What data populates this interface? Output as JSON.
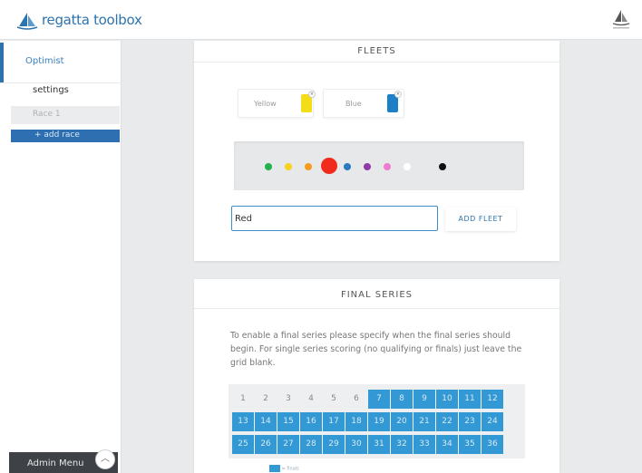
{
  "app": {
    "title": "regatta toolbox"
  },
  "sidebar": {
    "class_name": "Optimist",
    "settings_label": "settings",
    "race_label": "Race 1",
    "add_race_label": "+ add race",
    "admin_label": "Admin Menu"
  },
  "fleets": {
    "title": "FLEETS",
    "tags": [
      {
        "label": "Yellow",
        "color": "#f3dc1a"
      },
      {
        "label": "Blue",
        "color": "#1f7fc6"
      }
    ],
    "palette": [
      {
        "color": "#22b14c",
        "selected": false
      },
      {
        "color": "#f7d21e",
        "selected": false
      },
      {
        "color": "#f39c1f",
        "selected": false
      },
      {
        "color": "#f02a1d",
        "selected": true
      },
      {
        "color": "#2a7ac0",
        "selected": false
      },
      {
        "color": "#8f3aa6",
        "selected": false
      },
      {
        "color": "#f07ad0",
        "selected": false
      },
      {
        "color": "#ffffff",
        "selected": false
      },
      {
        "color": "#111111",
        "selected": false
      }
    ],
    "input_value": "Red",
    "add_button_label": "ADD FLEET"
  },
  "final_series": {
    "title": "FINAL SERIES",
    "description": "To enable a final series please specify when the final series should begin. For single series scoring (no qualifying or finals) just leave the grid blank.",
    "grid": {
      "rows": [
        [
          "1",
          "2",
          "3",
          "4",
          "5",
          "6",
          "7",
          "8",
          "9",
          "10",
          "11",
          "12"
        ],
        [
          "13",
          "14",
          "15",
          "16",
          "17",
          "18",
          "19",
          "20",
          "21",
          "22",
          "23",
          "24"
        ],
        [
          "25",
          "26",
          "27",
          "28",
          "29",
          "30",
          "31",
          "32",
          "33",
          "34",
          "35",
          "36"
        ]
      ],
      "first_selected": 7
    },
    "legend_label": "= finals"
  },
  "colors": {
    "accent": "#2d73ad",
    "grid_on": "#3399d4"
  }
}
